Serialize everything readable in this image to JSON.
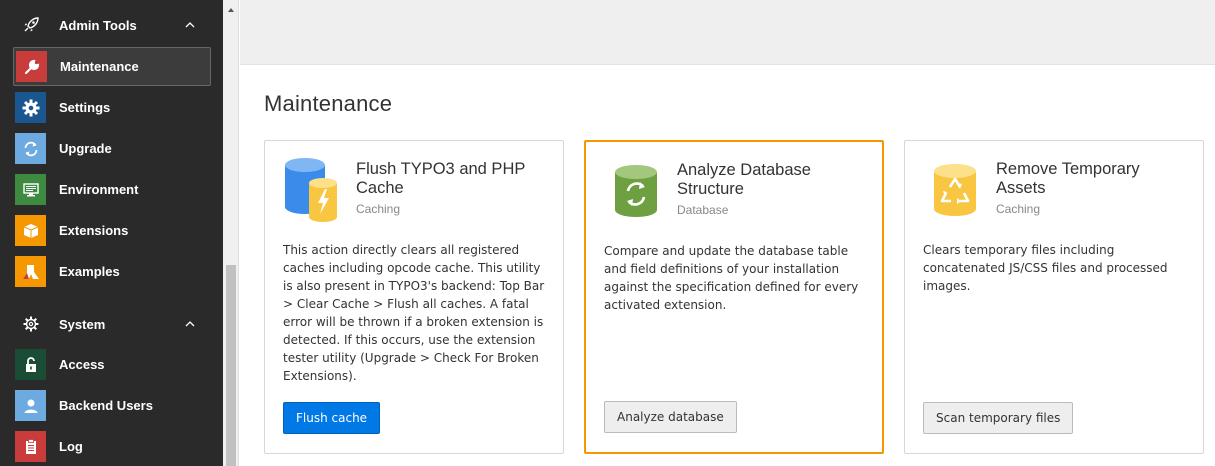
{
  "sidebar": {
    "admin_tools_label": "Admin Tools",
    "system_label": "System",
    "items": [
      {
        "label": "Maintenance",
        "icon": "wrench-icon",
        "color": "#c83c3c"
      },
      {
        "label": "Settings",
        "icon": "gear-icon",
        "color": "#1a568f"
      },
      {
        "label": "Upgrade",
        "icon": "refresh-icon",
        "color": "#6daae0"
      },
      {
        "label": "Environment",
        "icon": "environment-icon",
        "color": "#3f8a41"
      },
      {
        "label": "Extensions",
        "icon": "box-icon",
        "color": "#f49700"
      },
      {
        "label": "Examples",
        "icon": "flask-icon",
        "color": "#f49700"
      },
      {
        "label": "Access",
        "icon": "unlock-icon",
        "color": "#1b4d36"
      },
      {
        "label": "Backend Users",
        "icon": "user-icon",
        "color": "#6daae0"
      },
      {
        "label": "Log",
        "icon": "clipboard-icon",
        "color": "#c83c3c"
      }
    ]
  },
  "main": {
    "title": "Maintenance",
    "cards": [
      {
        "title": "Flush TYPO3 and PHP Cache",
        "subtitle": "Caching",
        "description": "This action directly clears all registered caches including opcode cache. This utility is also present in TYPO3's backend: Top Bar > Clear Cache > Flush all caches. A fatal error will be thrown if a broken extension is detected. If this occurs, use the extension tester utility (Upgrade > Check For Broken Extensions).",
        "button": "Flush cache",
        "icon": "cache-flush-icon"
      },
      {
        "title": "Analyze Database Structure",
        "subtitle": "Database",
        "description": "Compare and update the database table and field definitions of your installation against the specification defined for every activated extension.",
        "button": "Analyze database",
        "icon": "database-refresh-icon"
      },
      {
        "title": "Remove Temporary Assets",
        "subtitle": "Caching",
        "description": "Clears temporary files including concatenated JS/CSS files and processed images.",
        "button": "Scan temporary files",
        "icon": "recycle-icon"
      }
    ]
  },
  "colors": {
    "sidebar_bg": "#2a2a2a",
    "accent_orange": "#f49700",
    "primary_blue": "#0078e6"
  }
}
